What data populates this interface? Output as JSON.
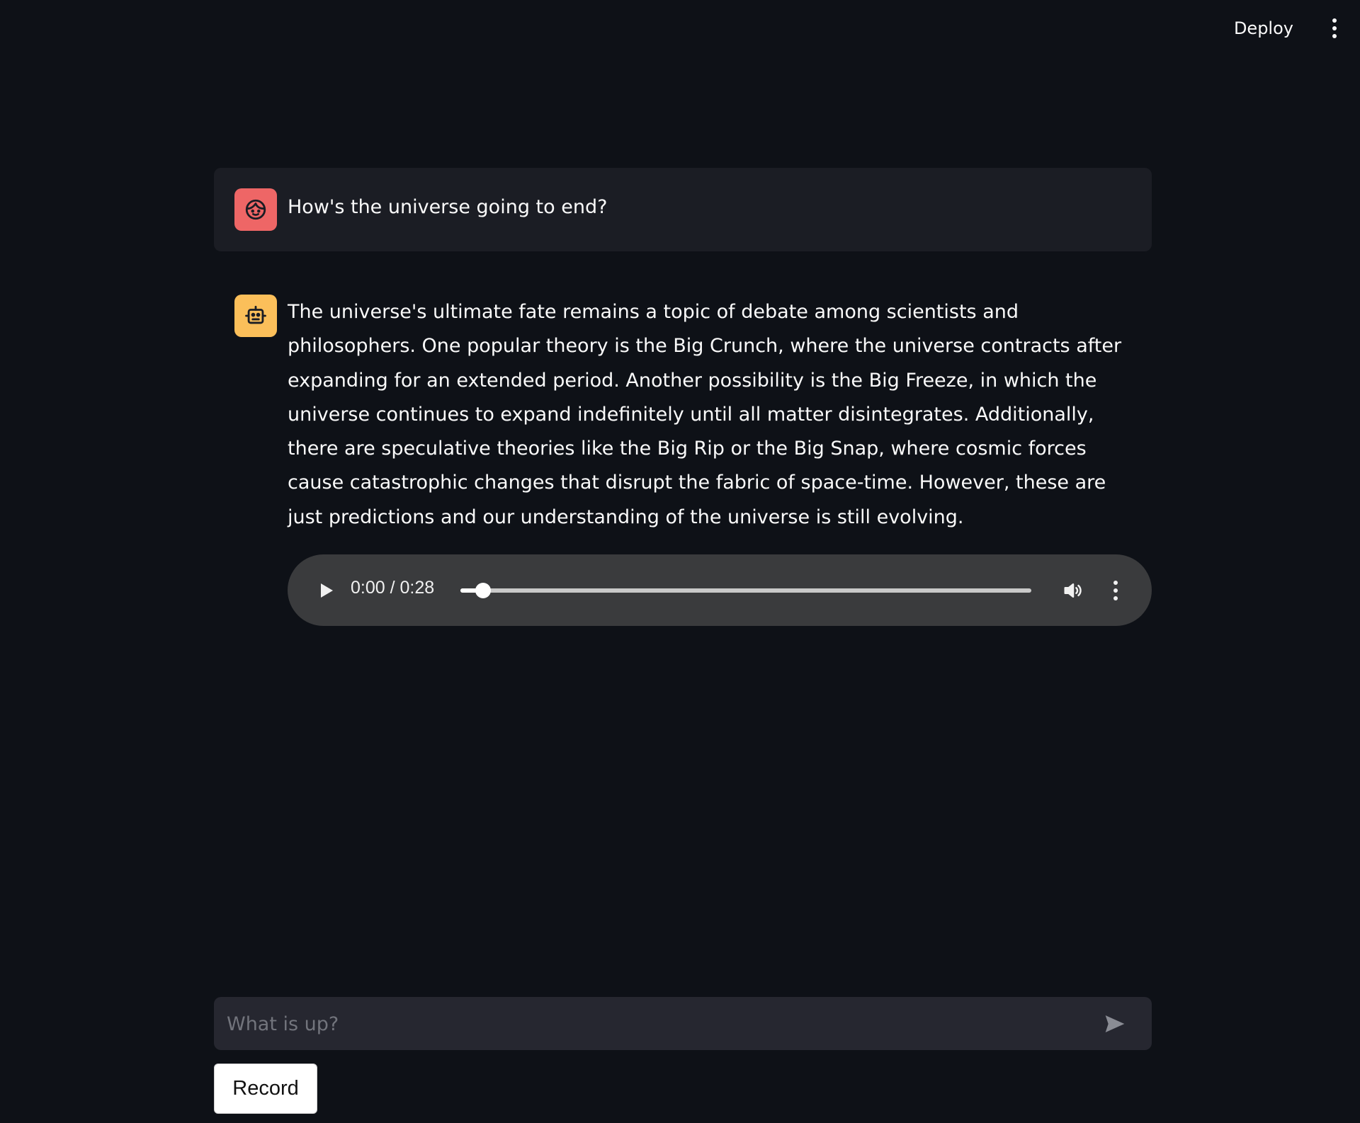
{
  "header": {
    "deploy_label": "Deploy",
    "menu_icon": "more-vertical-icon"
  },
  "messages": [
    {
      "role": "user",
      "avatar_icon": "face-icon",
      "avatar_color": "#ee6666",
      "text": "How's the universe going to end?"
    },
    {
      "role": "assistant",
      "avatar_icon": "robot-icon",
      "avatar_color": "#fbbf5a",
      "text": "The universe's ultimate fate remains a topic of debate among scientists and philosophers. One popular theory is the Big Crunch, where the universe contracts after expanding for an extended period. Another possibility is the Big Freeze, in which the universe continues to expand indefinitely until all matter disintegrates. Additionally, there are speculative theories like the Big Rip or the Big Snap, where cosmic forces cause catastrophic changes that disrupt the fabric of space-time. However, these are just predictions and our understanding of the universe is still evolving."
    }
  ],
  "audio_player": {
    "time_display": "0:00 / 0:28",
    "progress_fraction": 0.04,
    "play_icon": "play-icon",
    "volume_icon": "volume-icon",
    "menu_icon": "more-vertical-icon"
  },
  "chat_input": {
    "placeholder": "What is up?",
    "value": "",
    "send_icon": "send-icon"
  },
  "record_button": {
    "label": "Record"
  },
  "colors": {
    "background": "#0e1117",
    "user_message_bg": "#1b1d24",
    "audio_player_bg": "#3a3b3d",
    "input_bg": "#262730"
  }
}
